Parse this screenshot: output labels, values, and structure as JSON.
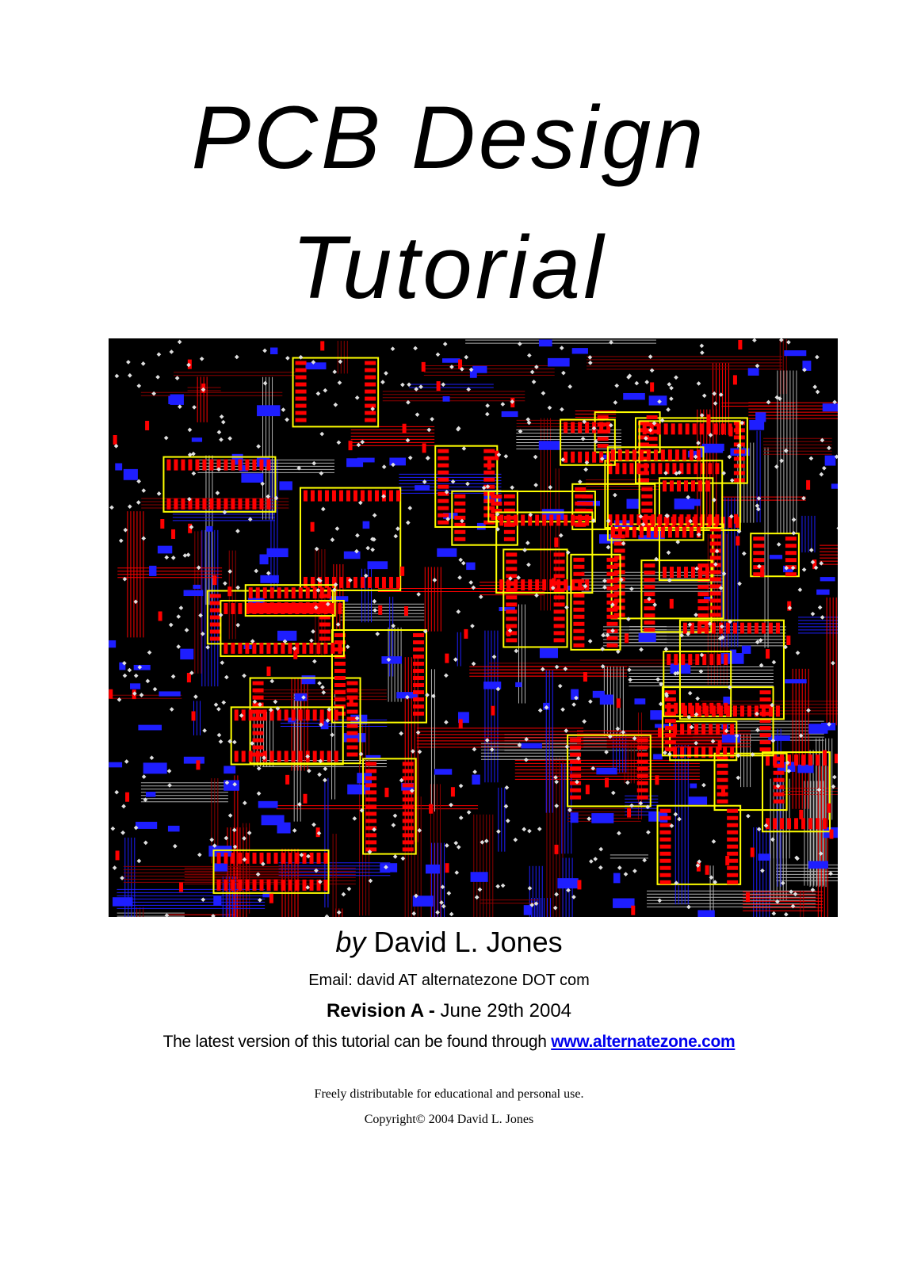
{
  "title": {
    "line1": "PCB Design",
    "line2": "Tutorial"
  },
  "cover_image": {
    "icon": "pcb-layout-image",
    "colors": {
      "background": "#000000",
      "copper_top": "#ff0000",
      "copper_bottom": "#1e1eff",
      "silkscreen": "#ffff00",
      "vias": "#e0e0e0",
      "dark_traces": "#8b0000"
    }
  },
  "author": {
    "by": "by",
    "name": "David L. Jones"
  },
  "email": "Email: david AT alternatezone DOT com",
  "revision": {
    "label": "Revision A -",
    "date": "June 29th 2004"
  },
  "latest": {
    "text": "The latest version of this tutorial can be found through",
    "link": "www.alternatezone.com"
  },
  "license": "Freely distributable for educational and personal use.",
  "copyright": "Copyright© 2004 David L. Jones"
}
